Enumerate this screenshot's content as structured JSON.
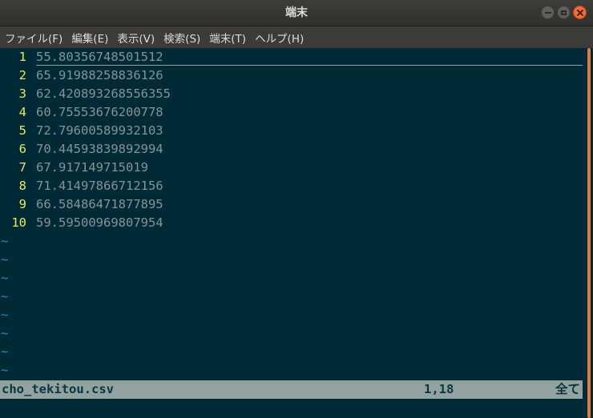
{
  "window": {
    "title": "端末"
  },
  "menu": [
    {
      "label": "ファイル(F)"
    },
    {
      "label": "編集(E)"
    },
    {
      "label": "表示(V)"
    },
    {
      "label": "検索(S)"
    },
    {
      "label": "端末(T)"
    },
    {
      "label": "ヘルプ(H)"
    }
  ],
  "editor": {
    "lines": [
      {
        "num": "1",
        "text": "55.80356748501512"
      },
      {
        "num": "2",
        "text": "65.91988258836126"
      },
      {
        "num": "3",
        "text": "62.420893268556355"
      },
      {
        "num": "4",
        "text": "60.75553676200778"
      },
      {
        "num": "5",
        "text": "72.79600589932103"
      },
      {
        "num": "6",
        "text": "70.44593839892994"
      },
      {
        "num": "7",
        "text": "67.917149715019"
      },
      {
        "num": "8",
        "text": "71.41497866712156"
      },
      {
        "num": "9",
        "text": "66.58486471877895"
      },
      {
        "num": "10",
        "text": "59.59500969807954"
      }
    ],
    "tilde": "~"
  },
  "status": {
    "filename": "cho_tekitou.csv",
    "position": "1,18",
    "percent": "全て"
  },
  "colors": {
    "background": "#002b36",
    "line_number": "#e8e85a",
    "text": "#839496",
    "tilde": "#268bd2",
    "statusline_bg": "#93a1a1",
    "statusline_fg": "#073642",
    "close_button": "#f06b38"
  }
}
